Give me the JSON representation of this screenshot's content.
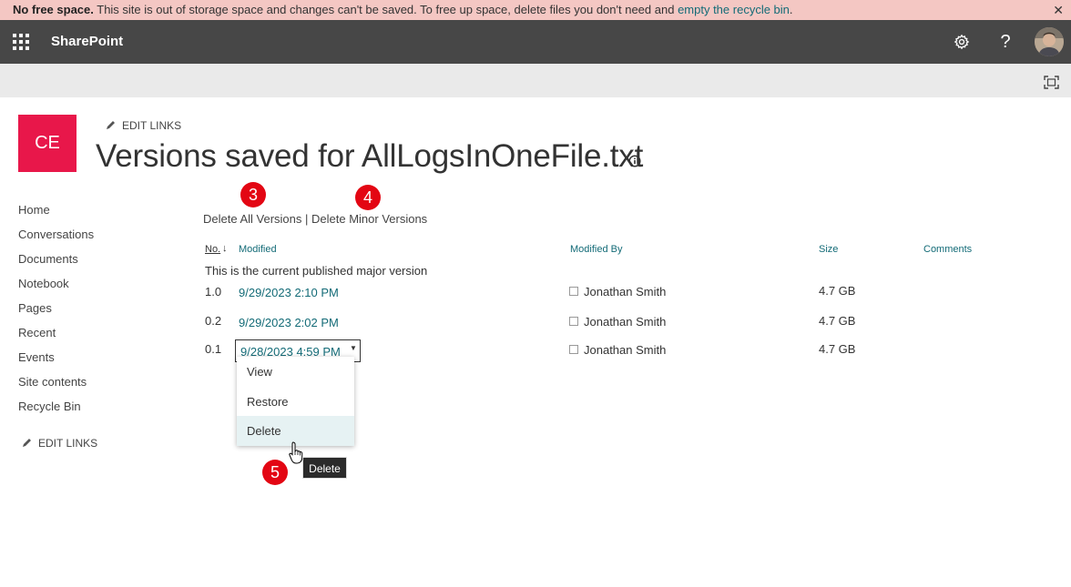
{
  "banner": {
    "bold": "No free space.",
    "text": " This site is out of storage space and changes can't be saved. To free up space, delete files you don't need and ",
    "link": "empty the recycle bin",
    "end": ".",
    "close": "✕"
  },
  "suitebar": {
    "brand": "SharePoint",
    "help": "?"
  },
  "site": {
    "logo_text": "CE",
    "logo_color": "#e8174a",
    "edit_links": "EDIT LINKS",
    "title": "Versions saved for AllLogsInOneFile.txt"
  },
  "nav": {
    "items": [
      {
        "label": "Home"
      },
      {
        "label": "Conversations"
      },
      {
        "label": "Documents"
      },
      {
        "label": "Notebook"
      },
      {
        "label": "Pages"
      },
      {
        "label": "Recent"
      },
      {
        "label": "Events"
      },
      {
        "label": "Site contents"
      },
      {
        "label": "Recycle Bin"
      }
    ],
    "edit_links": "EDIT LINKS"
  },
  "badges": {
    "b3": "3",
    "b4": "4",
    "b5": "5"
  },
  "actions": {
    "delete_all": "Delete All Versions",
    "separator": " | ",
    "delete_minor": "Delete Minor Versions"
  },
  "table": {
    "headers": {
      "no": "No.",
      "modified": "Modified",
      "modified_by": "Modified By",
      "size": "Size",
      "comments": "Comments"
    },
    "sort_indicator": "↓",
    "current_note": "This is the current published major version",
    "rows": [
      {
        "no": "1.0",
        "modified": "9/29/2023 2:10 PM",
        "by": "Jonathan Smith",
        "size": "4.7 GB"
      },
      {
        "no": "0.2",
        "modified": "9/29/2023 2:02 PM",
        "by": "Jonathan Smith",
        "size": "4.7 GB"
      },
      {
        "no": "0.1",
        "modified": "9/28/2023 4:59 PM",
        "by": "Jonathan Smith",
        "size": "4.7 GB"
      }
    ]
  },
  "context_menu": {
    "items": [
      {
        "label": "View"
      },
      {
        "label": "Restore"
      },
      {
        "label": "Delete"
      }
    ]
  },
  "tooltip": "Delete",
  "colors": {
    "accent": "#136b77",
    "suitebar": "#474747",
    "banner": "#f4c7c3",
    "badge": "#e30613"
  }
}
